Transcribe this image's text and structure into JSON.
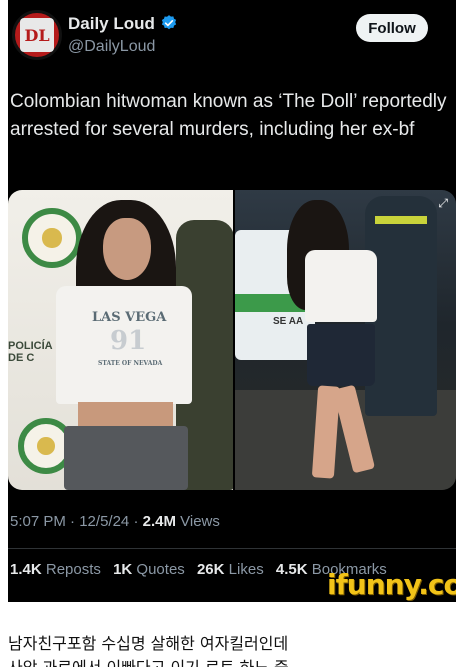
{
  "tweet": {
    "author_name": "Daily Loud",
    "author_handle": "@DailyLoud",
    "avatar_letters": "DL",
    "follow_label": "Follow",
    "text": "Colombian hitwoman known as ‘The Doll’ reportedly arrested for several murders, including her ex-bf",
    "time": "5:07 PM",
    "date": "12/5/24",
    "views_count": "2.4M",
    "views_label": "Views",
    "stats": [
      {
        "num": "1.4K",
        "label": "Reposts"
      },
      {
        "num": "1K",
        "label": "Quotes"
      },
      {
        "num": "26K",
        "label": "Likes"
      },
      {
        "num": "4.5K",
        "label": "Bookmarks"
      }
    ],
    "verified_color": "#1d9bf0",
    "icons": [
      "verified-badge-icon",
      "expand-icon"
    ]
  },
  "media": {
    "left_photo": {
      "wall_text": "POLICÍA\nDE C",
      "shirt_text_1": "LAS VEGA",
      "shirt_text_2": "91",
      "shirt_text_3": "STATE OF NEVADA"
    },
    "right_photo": {
      "car_text": "SE AA"
    }
  },
  "watermark": "ifunny.co",
  "caption": {
    "line1": "남자친구포함 수십명 살해한 여자킬러인데",
    "line2": "사악 과로에서 이빠다고 이기 로토 하느 중"
  }
}
